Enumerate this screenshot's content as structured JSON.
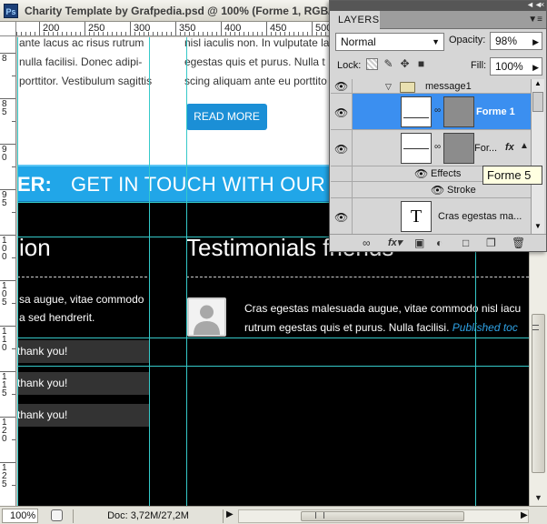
{
  "document": {
    "title": "Charity Template by Grafpedia.psd @ 100% (Forme 1, RGB/8",
    "app_icon": "Ps"
  },
  "rulers": {
    "top_labels": [
      "200",
      "250",
      "300",
      "350",
      "400",
      "450",
      "500"
    ],
    "left_labels": [
      "8",
      "8 5",
      "9 0",
      "9 5",
      "1 0 0",
      "1 0 5",
      "1 1 0",
      "1 1 5",
      "1 2 0",
      "1 2 5"
    ]
  },
  "canvas": {
    "body_lines_left": [
      "ante lacus ac risus rutrum",
      "nulla facilisi. Donec adipi-",
      "porttitor. Vestibulum sagittis"
    ],
    "body_lines_right": [
      "nisl iaculis non. In vulputate la",
      "egestas quis et purus. Nulla t",
      "scing aliquam ante eu porttito"
    ],
    "read_more": "READ MORE",
    "banner_prefix": "ER:",
    "banner_text": "GET IN TOUCH WITH OUR T",
    "heading_left": "ion",
    "heading_right": "Testimonials friends",
    "left_para": [
      "sa augue, vitae commodo",
      "a sed hendrerit."
    ],
    "thank_rows": [
      "thank you!",
      "thank you!",
      "thank you!"
    ],
    "testimonial_line1": "Cras egestas malesuada augue, vitae commodo nisl iacu",
    "testimonial_line2": "rutrum egestas quis et purus. Nulla facilisi.",
    "testimonial_link": "Published toc",
    "colors": {
      "accent": "#21a6e8",
      "guide": "#35c9c9",
      "button": "#1b8fd6"
    }
  },
  "statusbar": {
    "zoom": "100%",
    "doc_size": "Doc: 3,72M/27,2M"
  },
  "layers_panel": {
    "tab": "LAYERS",
    "blend_mode": "Normal",
    "opacity_label": "Opacity:",
    "opacity": "98%",
    "lock_label": "Lock:",
    "fill_label": "Fill:",
    "fill": "100%",
    "layers": {
      "group": "message1",
      "selected": "Forme 1",
      "second": "For...",
      "effects": "Effects",
      "stroke": "Stroke",
      "text_layer": "Cras egestas ma...",
      "text_thumb": "T"
    },
    "tooltip": "Forme 5",
    "bottom_icons": [
      "link-icon",
      "fx-icon",
      "mask-icon",
      "adjustment-icon",
      "group-icon",
      "new-layer-icon",
      "trash-icon"
    ]
  }
}
